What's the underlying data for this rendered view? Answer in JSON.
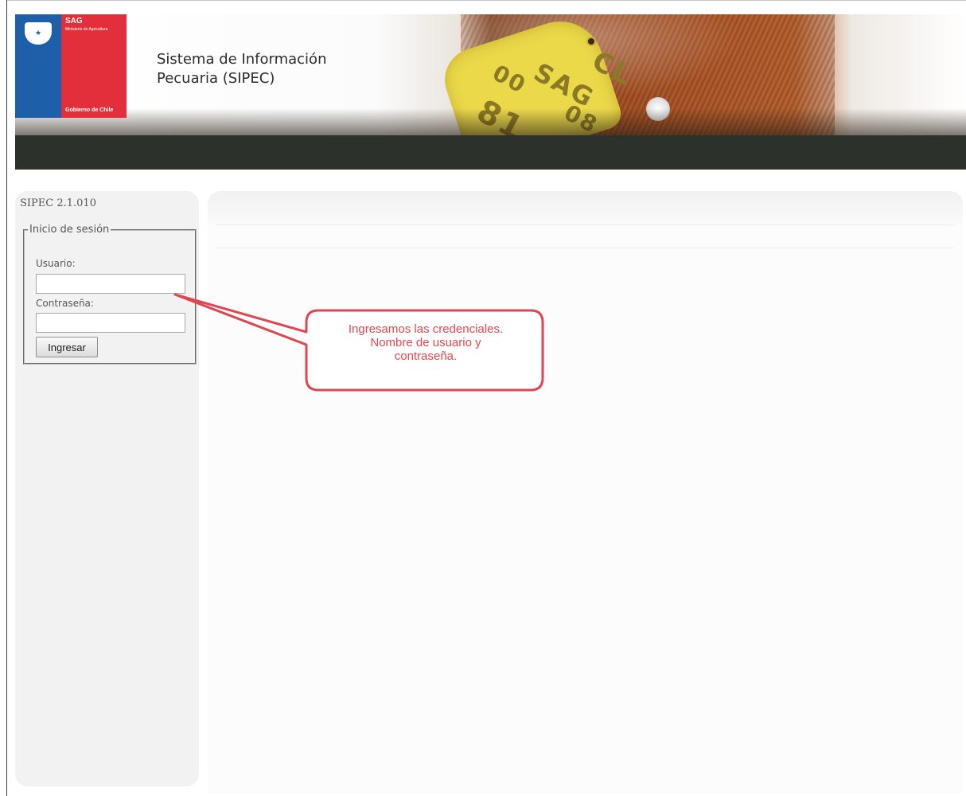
{
  "header": {
    "logo": {
      "agency": "SAG",
      "ministry": "Ministerio de Agricultura",
      "government": "Gobierno de Chile"
    },
    "site_title_line1": "Sistema de Información",
    "site_title_line2": "Pecuaria (SIPEC)",
    "banner_tag_text": [
      "CL",
      "SAG",
      "00",
      "08",
      "81"
    ]
  },
  "sidebar": {
    "version": "SIPEC 2.1.010",
    "login": {
      "legend": "Inicio de sesión",
      "user_label": "Usuario:",
      "user_value": "",
      "password_label": "Contraseña:",
      "password_value": "",
      "submit_label": "Ingresar"
    }
  },
  "annotation": {
    "line1": "Ingresamos las credenciales.",
    "line2": "Nombre de usuario y",
    "line3": "contraseña.",
    "color": "#e8464f"
  },
  "colors": {
    "logo_blue": "#1d5fa8",
    "logo_red": "#e22f3b",
    "nav_bar": "#2c312b",
    "panel_bg": "#f2f2f2"
  }
}
